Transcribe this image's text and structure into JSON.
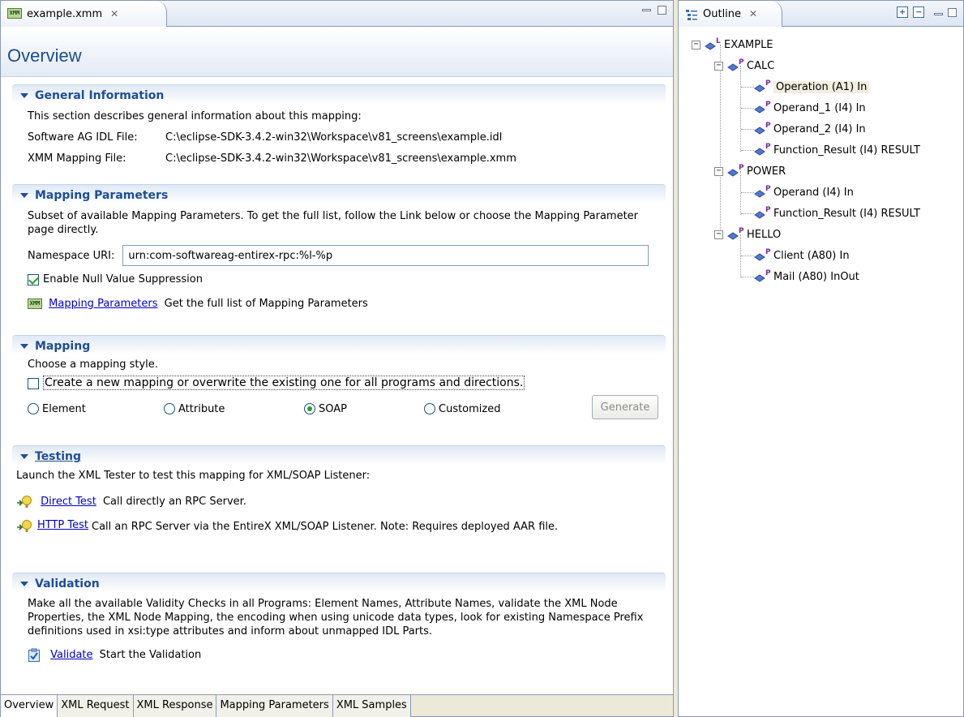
{
  "editor": {
    "tab_title": "example.xmm",
    "file_icon_text": "XMM",
    "page_title": "Overview",
    "sections": {
      "general": {
        "title": "General Information",
        "description": "This section describes general information about this mapping:",
        "idl_label": "Software AG IDL File:",
        "idl_value": "C:\\eclipse-SDK-3.4.2-win32\\Workspace\\v81_screens\\example.idl",
        "xmm_label": "XMM Mapping File:",
        "xmm_value": "C:\\eclipse-SDK-3.4.2-win32\\Workspace\\v81_screens\\example.xmm"
      },
      "mapping_params": {
        "title": "Mapping Parameters",
        "description": "Subset of available Mapping Parameters. To get the full list, follow the Link below or choose the Mapping Parameter page directly.",
        "namespace_label": "Namespace URI:",
        "namespace_value": "urn:com-softwareag-entirex-rpc:%l-%p",
        "null_suppression_label": "Enable Null Value Suppression",
        "null_suppression_checked": true,
        "link_label": "Mapping Parameters",
        "link_desc": "Get the full list of Mapping Parameters"
      },
      "mapping": {
        "title": "Mapping",
        "description": "Choose a mapping style.",
        "overwrite_label": "Create a new mapping or overwrite the existing one for all programs and directions.",
        "overwrite_checked": false,
        "radio_options": [
          "Element",
          "Attribute",
          "SOAP",
          "Customized"
        ],
        "selected": "SOAP",
        "generate_label": "Generate"
      },
      "testing": {
        "title": "Testing",
        "description": "Launch the XML Tester to test this mapping for XML/SOAP Listener:",
        "direct_link": "Direct Test",
        "direct_desc": "Call directly an RPC Server.",
        "http_link": "HTTP Test",
        "http_desc": "Call an RPC Server via the EntireX XML/SOAP Listener. Note: Requires deployed AAR file."
      },
      "validation": {
        "title": "Validation",
        "description": "Make all the available Validity Checks in all Programs: Element Names, Attribute Names, validate the XML Node Properties, the XML Node Mapping, the encoding when using unicode data types, look for existing Namespace Prefix definitions used in xsi:type attributes and inform about unmapped IDL Parts.",
        "link_label": "Validate",
        "link_desc": "Start the Validation"
      }
    },
    "bottom_tabs": [
      "Overview",
      "XML Request",
      "XML Response",
      "Mapping Parameters",
      "XML Samples"
    ],
    "active_bottom_tab": "Overview"
  },
  "outline": {
    "tab_title": "Outline",
    "tree": [
      {
        "label": "EXAMPLE",
        "badge": "L"
      },
      {
        "label": "CALC",
        "badge": "P"
      },
      {
        "label": "Operation  (A1) In",
        "badge": "P",
        "selected": true
      },
      {
        "label": "Operand_1  (I4) In",
        "badge": "P"
      },
      {
        "label": "Operand_2  (I4) In",
        "badge": "P"
      },
      {
        "label": "Function_Result  (I4) RESULT",
        "badge": "P"
      },
      {
        "label": "POWER",
        "badge": "P"
      },
      {
        "label": "Operand  (I4) In",
        "badge": "P"
      },
      {
        "label": "Function_Result  (I4) RESULT",
        "badge": "P"
      },
      {
        "label": "HELLO",
        "badge": "P"
      },
      {
        "label": "Client  (A80) In",
        "badge": "P"
      },
      {
        "label": "Mail  (A80) InOut",
        "badge": "P"
      }
    ]
  },
  "colors": {
    "section_title": "#1f4e95",
    "page_title": "#1c4d8c",
    "link": "#0000cc",
    "gem_blue": "#5577cc",
    "badge_purple": "#7a2a9a"
  }
}
